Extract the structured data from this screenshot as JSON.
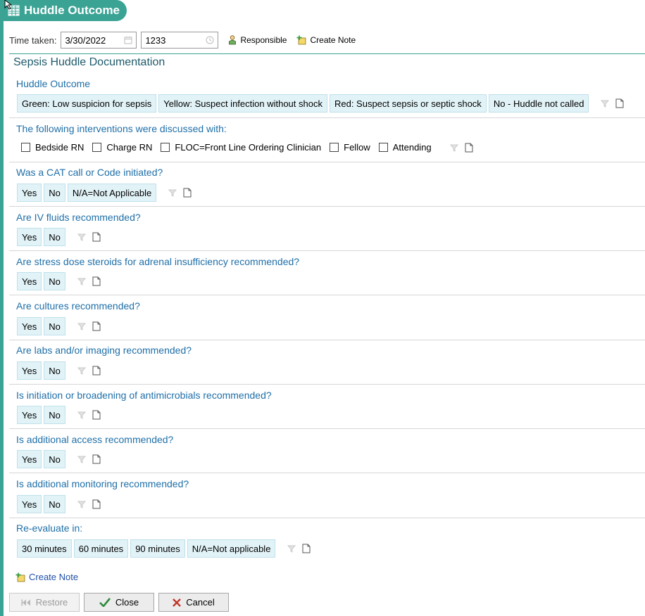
{
  "header": {
    "title": "Huddle Outcome",
    "icon": "grid-table-icon"
  },
  "time": {
    "label": "Time taken:",
    "date_value": "3/30/2022",
    "time_value": "1233",
    "responsible_label": "Responsible",
    "create_note_label": "Create Note"
  },
  "section_title": "Sepsis Huddle Documentation",
  "questions": [
    {
      "label": "Huddle Outcome",
      "options": [
        "Green: Low suspicion for sepsis",
        "Yellow: Suspect infection without shock",
        "Red: Suspect sepsis or septic shock",
        "No - Huddle not called"
      ]
    },
    {
      "label": "The following interventions were discussed with:",
      "checkboxes": [
        "Bedside RN",
        "Charge RN",
        "FLOC=Front Line Ordering Clinician",
        "Fellow",
        "Attending"
      ]
    },
    {
      "label": "Was a CAT call or Code initiated?",
      "options": [
        "Yes",
        "No",
        "N/A=Not Applicable"
      ]
    },
    {
      "label": "Are IV fluids recommended?",
      "options": [
        "Yes",
        "No"
      ]
    },
    {
      "label": "Are stress dose steroids for adrenal insufficiency recommended?",
      "options": [
        "Yes",
        "No"
      ]
    },
    {
      "label": "Are cultures recommended?",
      "options": [
        "Yes",
        "No"
      ]
    },
    {
      "label": "Are labs and/or imaging recommended?",
      "options": [
        "Yes",
        "No"
      ]
    },
    {
      "label": "Is initiation or broadening of antimicrobials recommended?",
      "options": [
        "Yes",
        "No"
      ]
    },
    {
      "label": "Is additional access recommended?",
      "options": [
        "Yes",
        "No"
      ]
    },
    {
      "label": "Is additional monitoring recommended?",
      "options": [
        "Yes",
        "No"
      ]
    },
    {
      "label": "Re-evaluate in:",
      "options": [
        "30 minutes",
        "60 minutes",
        "90 minutes",
        "N/A=Not applicable"
      ]
    }
  ],
  "footer": {
    "create_note_label": "Create Note",
    "restore_label": "Restore",
    "close_label": "Close",
    "cancel_label": "Cancel"
  },
  "colors": {
    "accent": "#3aa394",
    "question_text": "#1f6fa8",
    "option_bg": "#e2f3f8"
  }
}
